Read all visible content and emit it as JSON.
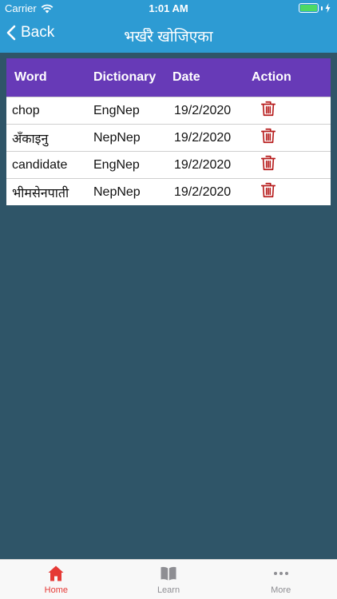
{
  "status_bar": {
    "carrier": "Carrier",
    "time": "1:01 AM"
  },
  "nav": {
    "back_label": "Back",
    "title": "भर्खरै खोजिएका"
  },
  "table": {
    "headers": [
      "Word",
      "Dictionary",
      "Date",
      "Action"
    ],
    "rows": [
      {
        "word": "chop",
        "dictionary": "EngNep",
        "date": "19/2/2020"
      },
      {
        "word": "अँकाइनु",
        "dictionary": "NepNep",
        "date": "19/2/2020"
      },
      {
        "word": "candidate",
        "dictionary": "EngNep",
        "date": "19/2/2020"
      },
      {
        "word": "भीमसेनपाती",
        "dictionary": "NepNep",
        "date": "19/2/2020"
      }
    ]
  },
  "tabs": [
    {
      "label": "Home",
      "icon": "home-icon",
      "active": true
    },
    {
      "label": "Learn",
      "icon": "book-icon",
      "active": false
    },
    {
      "label": "More",
      "icon": "more-icon",
      "active": false
    }
  ],
  "colors": {
    "header": "#2d9bd3",
    "table_header": "#673ab7",
    "background": "#2f5568",
    "delete": "#b71c1c",
    "active_tab": "#e53935"
  }
}
